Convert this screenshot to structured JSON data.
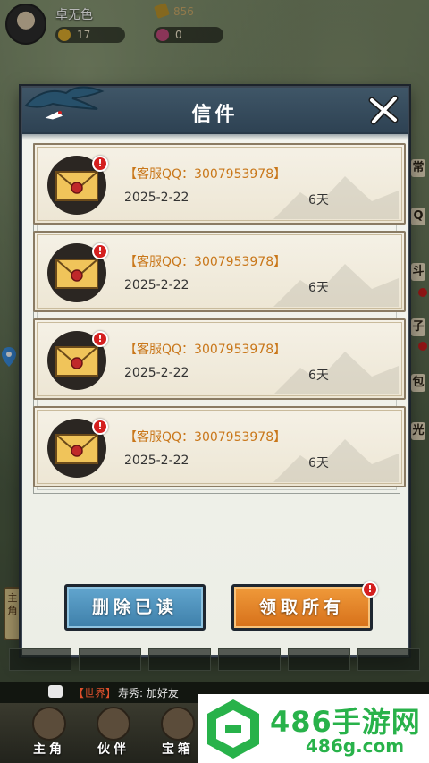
{
  "player": {
    "name": "卓无色",
    "coins": "17",
    "gems": "0",
    "currency_right": "856"
  },
  "mail_panel": {
    "title": "信件",
    "items": [
      {
        "sender": "【客服QQ：3007953978】",
        "date": "2025-2-22",
        "expires": "6天"
      },
      {
        "sender": "【客服QQ：3007953978】",
        "date": "2025-2-22",
        "expires": "6天"
      },
      {
        "sender": "【客服QQ：3007953978】",
        "date": "2025-2-22",
        "expires": "6天"
      },
      {
        "sender": "【客服QQ：3007953978】",
        "date": "2025-2-22",
        "expires": "6天"
      }
    ],
    "unread_badge": "!",
    "delete_read_label": "删除已读",
    "claim_all_label": "领取所有"
  },
  "side_labels": {
    "right": [
      "常",
      "Q",
      "斗",
      "子",
      "包",
      "光"
    ],
    "left_tab": "主角",
    "left_small": "修"
  },
  "chat": {
    "channel": "【世界】",
    "message": "寿秀: 加好友"
  },
  "nav": {
    "items": [
      {
        "label": "主角"
      },
      {
        "label": "伙伴"
      },
      {
        "label": "宝箱"
      }
    ]
  },
  "watermark": {
    "title": "486手游网",
    "domain": "486g.com"
  },
  "colors": {
    "header": "#3f5667",
    "delete_button": "#4f92bc",
    "claim_button": "#e38428",
    "sender_text": "#c9771a",
    "badge": "#d41f1f",
    "watermark": "#28b24a"
  }
}
